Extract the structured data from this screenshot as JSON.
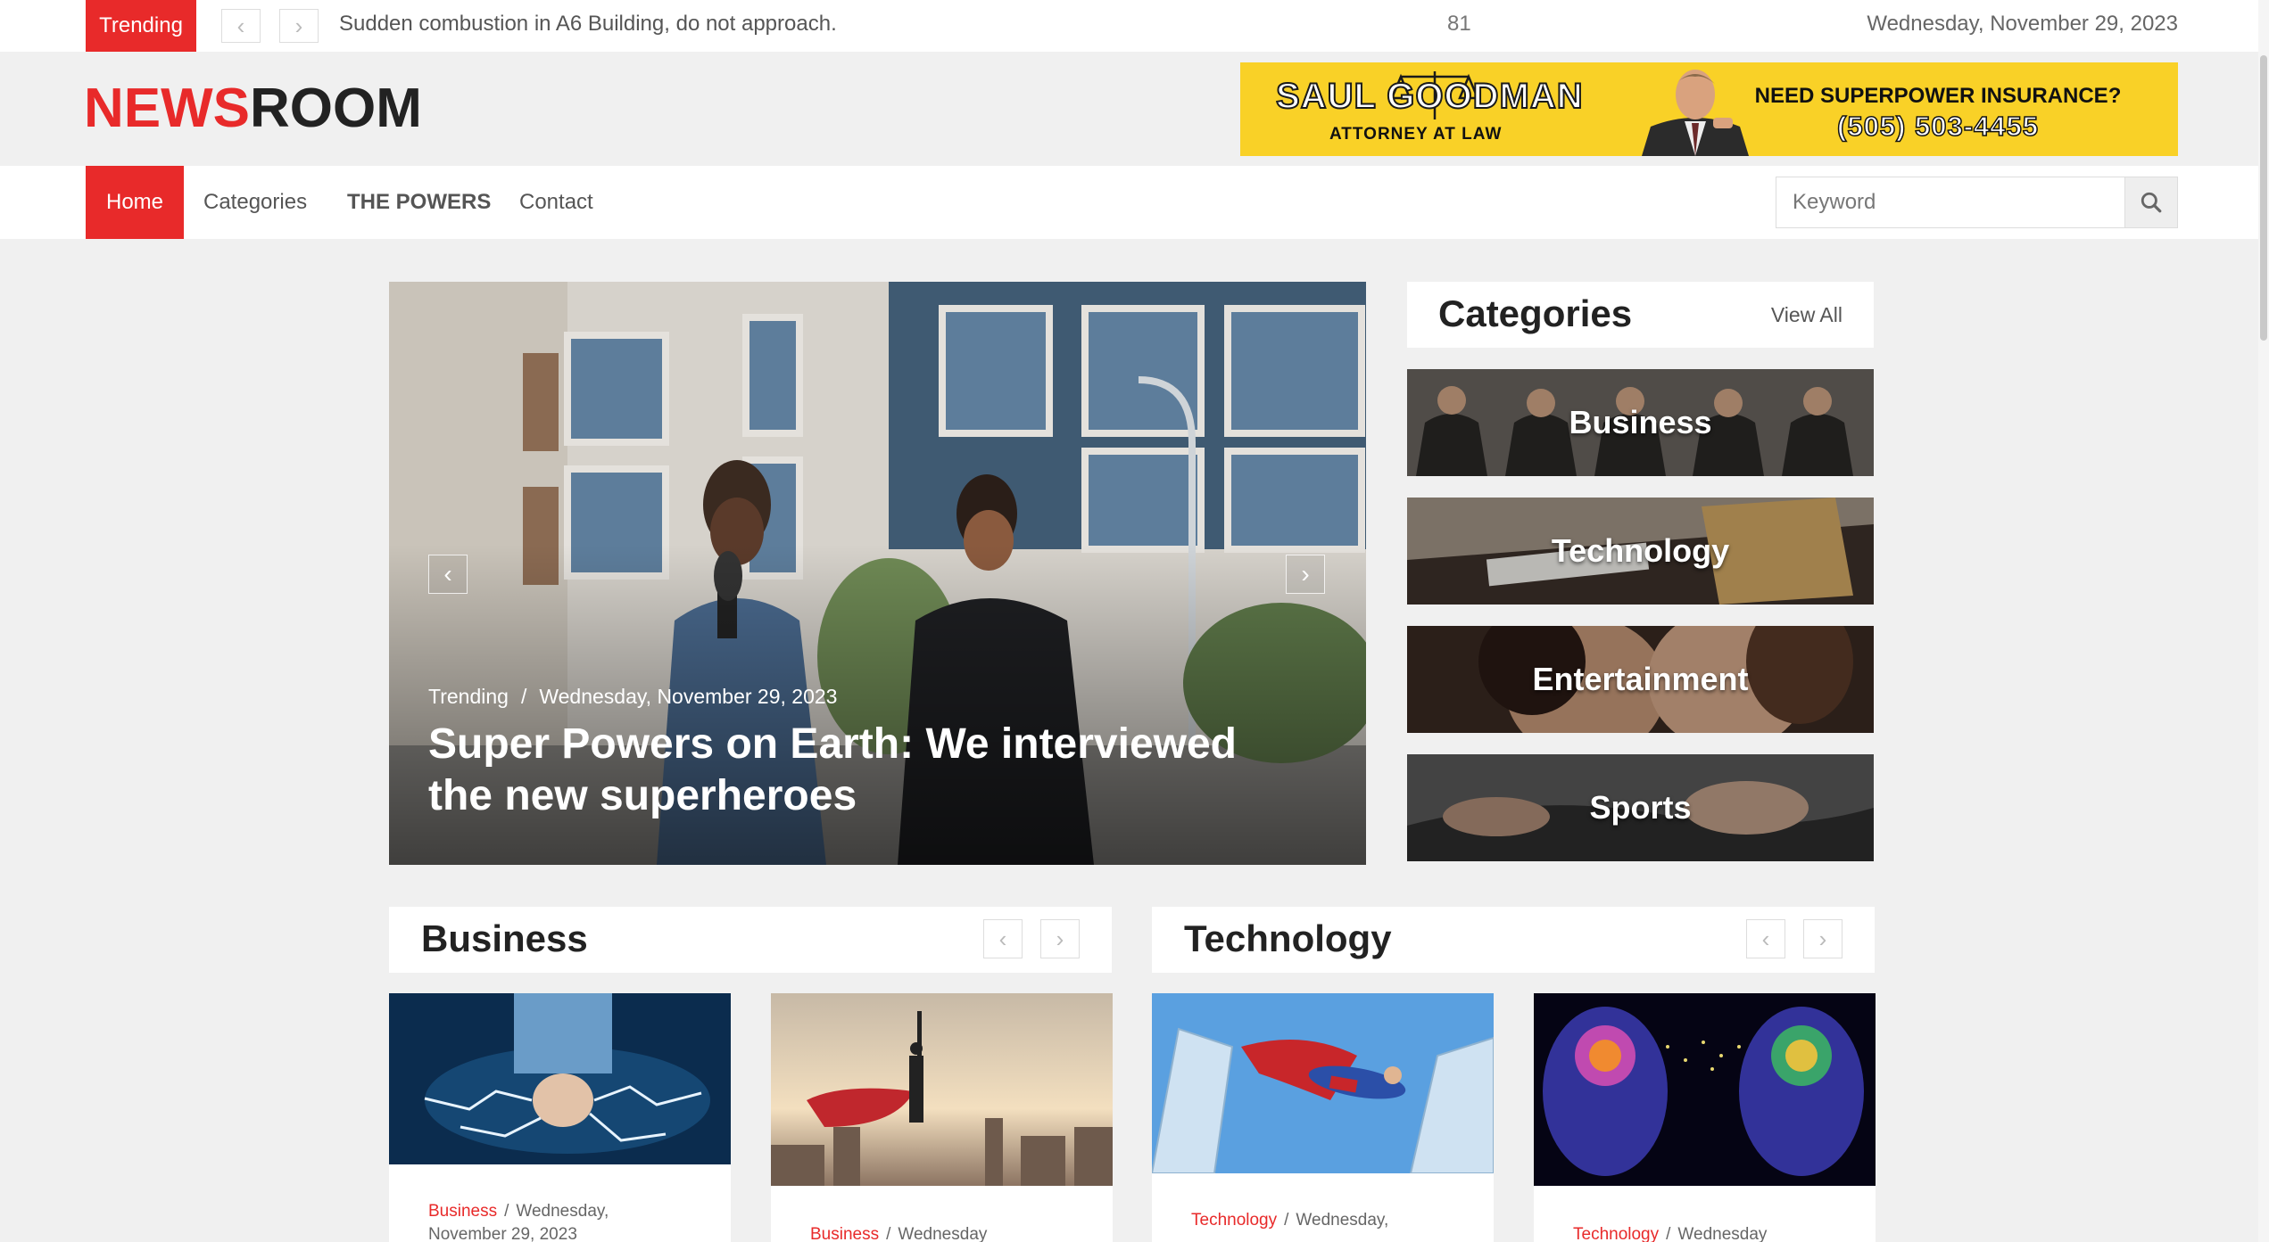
{
  "topbar": {
    "trending_label": "Trending",
    "ticker_text": "Sudden combustion in A6 Building, do not approach.",
    "ticker_number": "81",
    "date": "Wednesday, November 29, 2023"
  },
  "logo": {
    "part1": "NEWS",
    "part2": "ROOM"
  },
  "ad": {
    "name": "SAUL GOODMAN",
    "subtitle": "ATTORNEY AT LAW",
    "question": "NEED SUPERPOWER INSURANCE?",
    "phone": "(505) 503-4455"
  },
  "nav": {
    "items": [
      {
        "label": "Home"
      },
      {
        "label": "Categories"
      },
      {
        "label": "THE POWERS"
      },
      {
        "label": "Contact"
      }
    ],
    "search_placeholder": "Keyword"
  },
  "hero": {
    "category": "Trending",
    "separator": "/",
    "date": "Wednesday, November 29, 2023",
    "title": "Super Powers on Earth: We interviewed the new superheroes"
  },
  "categories_panel": {
    "title": "Categories",
    "view_all": "View All",
    "items": [
      {
        "label": "Business"
      },
      {
        "label": "Technology"
      },
      {
        "label": "Entertainment"
      },
      {
        "label": "Sports"
      }
    ]
  },
  "sections": [
    {
      "title": "Business",
      "cards": [
        {
          "category": "Business",
          "date_line1": "Wednesday,",
          "date_line2": "November 29, 2023"
        },
        {
          "category": "Business",
          "date_line1": "Wednesday"
        }
      ]
    },
    {
      "title": "Technology",
      "cards": [
        {
          "category": "Technology",
          "date_line1": "Wednesday,"
        },
        {
          "category": "Technology",
          "date_line1": "Wednesday"
        }
      ]
    }
  ],
  "colors": {
    "accent": "#e82a2a",
    "ad_background": "#f9d127",
    "page_background": "#f0f0f0"
  }
}
